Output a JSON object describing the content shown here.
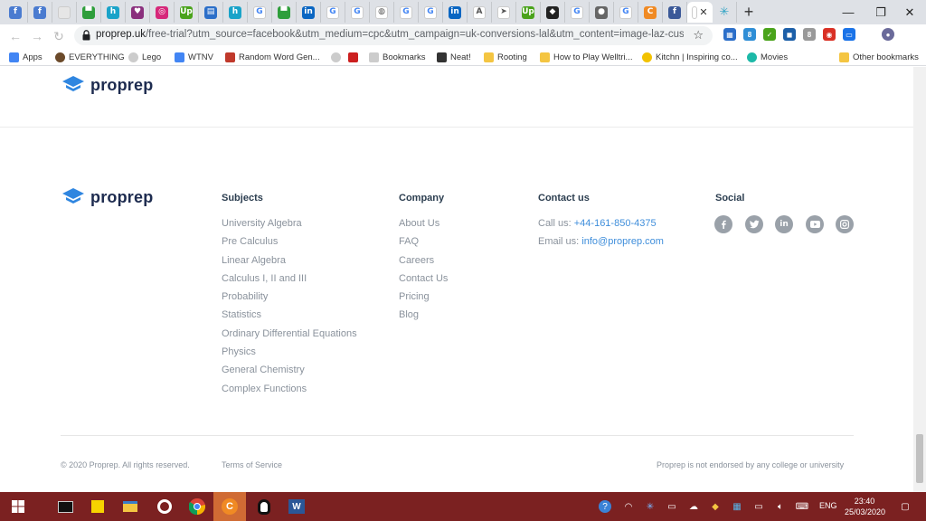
{
  "browser": {
    "tabs": [
      {
        "icon": "quora-icon",
        "glyph": "f",
        "color": "#4a7bd0"
      },
      {
        "icon": "quora-icon",
        "glyph": "f",
        "color": "#4a7bd0"
      },
      {
        "icon": "blank-page-icon",
        "glyph": "",
        "color": "#e6e6e6"
      },
      {
        "icon": "trello-icon",
        "glyph": "▀",
        "color": "#2e9e3b"
      },
      {
        "icon": "houzz-icon",
        "glyph": "h",
        "color": "#1aa3c9"
      },
      {
        "icon": "heart-app-icon",
        "glyph": "♥",
        "color": "#8a2f7d"
      },
      {
        "icon": "instagram-icon",
        "glyph": "◎",
        "color": "#d6287a"
      },
      {
        "icon": "upwork-icon",
        "glyph": "Up",
        "color": "#4aa31b"
      },
      {
        "icon": "book-icon",
        "glyph": "▤",
        "color": "#2c6fc9"
      },
      {
        "icon": "houzz-icon",
        "glyph": "h",
        "color": "#1aa3c9"
      },
      {
        "icon": "google-icon",
        "glyph": "G",
        "color": "#ffffff"
      },
      {
        "icon": "trello-icon",
        "glyph": "▀",
        "color": "#2e9e3b"
      },
      {
        "icon": "linkedin-icon",
        "glyph": "in",
        "color": "#0a66c2"
      },
      {
        "icon": "google-icon",
        "glyph": "G",
        "color": "#ffffff"
      },
      {
        "icon": "google-icon",
        "glyph": "G",
        "color": "#ffffff"
      },
      {
        "icon": "document-icon",
        "glyph": "◍",
        "color": "#ffffff"
      },
      {
        "icon": "google-icon",
        "glyph": "G",
        "color": "#ffffff"
      },
      {
        "icon": "google-icon",
        "glyph": "G",
        "color": "#ffffff"
      },
      {
        "icon": "linkedin-icon",
        "glyph": "in",
        "color": "#0a66c2"
      },
      {
        "icon": "pen-icon",
        "glyph": "A",
        "color": "#ffffff"
      },
      {
        "icon": "arrow-icon",
        "glyph": "➤",
        "color": "#ffffff"
      },
      {
        "icon": "upwork-icon",
        "glyph": "Up",
        "color": "#4aa31b"
      },
      {
        "icon": "dark-circle-icon",
        "glyph": "◆",
        "color": "#222222"
      },
      {
        "icon": "google-icon",
        "glyph": "G",
        "color": "#ffffff"
      },
      {
        "icon": "grey-circle-icon",
        "glyph": "●",
        "color": "#666666"
      },
      {
        "icon": "google-icon",
        "glyph": "G",
        "color": "#ffffff"
      },
      {
        "icon": "orange-c-icon",
        "glyph": "C",
        "color": "#f08a24"
      },
      {
        "icon": "facebook-icon",
        "glyph": "f",
        "color": "#3b5998"
      }
    ],
    "active_tab": {
      "icon": "page-icon",
      "close": "✕"
    },
    "extra_tab": {
      "icon": "snowflake-icon",
      "glyph": "✳",
      "color": "#2fa3c4"
    },
    "new_tab": "+",
    "window": {
      "minimize": "—",
      "restore": "❐",
      "close": "✕"
    },
    "url_host": "proprep.uk",
    "url_rest": "/free-trial?utm_source=facebook&utm_medium=cpc&utm_campaign=uk-conversions-lal&utm_content=image-laz-customized...",
    "star": "☆",
    "bookmarks": [
      {
        "label": "Apps",
        "icon": "apps-grid-icon",
        "color": "#4285f4"
      },
      {
        "label": "EVERYTHING",
        "icon": "user-avatar-icon",
        "color": "#6b4a2a"
      },
      {
        "label": "Lego",
        "icon": "globe-icon",
        "color": "#cccccc"
      },
      {
        "label": "WTNV",
        "icon": "google-icon",
        "color": "#4285f4"
      },
      {
        "label": "Random Word Gen...",
        "icon": "random-word-icon",
        "color": "#c0392b"
      },
      {
        "label": "",
        "icon": "globe-icon",
        "color": "#cccccc"
      },
      {
        "label": "",
        "icon": "heart-icon",
        "color": "#cc1f1f"
      },
      {
        "label": "Bookmarks",
        "icon": "star-icon",
        "color": "#cccccc"
      },
      {
        "label": "Neat!",
        "icon": "question-icon",
        "color": "#333333"
      },
      {
        "label": "Rooting",
        "icon": "folder-icon",
        "color": "#f4c542"
      },
      {
        "label": "How to Play Welltri...",
        "icon": "folder-icon",
        "color": "#f4c542"
      },
      {
        "label": "Kitchn | Inspiring co...",
        "icon": "kitchn-icon",
        "color": "#f2c200"
      },
      {
        "label": "Movies",
        "icon": "play-icon",
        "color": "#1db9a8"
      },
      {
        "label": "Other bookmarks",
        "icon": "folder-icon",
        "color": "#f4c542"
      }
    ]
  },
  "page": {
    "brand": "proprep",
    "columns": {
      "subjects": {
        "title": "Subjects",
        "items": [
          "University Algebra",
          "Pre Calculus",
          "Linear Algebra",
          "Calculus I, II and III",
          "Probability",
          "Statistics",
          "Ordinary Differential Equations",
          "Physics",
          "General Chemistry",
          "Complex Functions"
        ]
      },
      "company": {
        "title": "Company",
        "items": [
          "About Us",
          "FAQ",
          "Careers",
          "Contact Us",
          "Pricing",
          "Blog"
        ]
      },
      "contact": {
        "title": "Contact us",
        "phone_label": "Call us:",
        "phone": "+44-161-850-4375",
        "email_label": "Email us:",
        "email": "info@proprep.com"
      },
      "social": {
        "title": "Social",
        "icons": [
          "facebook-icon",
          "twitter-icon",
          "linkedin-icon",
          "youtube-icon",
          "instagram-icon"
        ]
      }
    },
    "footer": {
      "copyright": "© 2020 Proprep. All rights reserved.",
      "terms": "Terms of Service",
      "disclaimer": "Proprep is not endorsed by any college or university"
    },
    "accent_color": "#3f8edb",
    "logo_color": "#2f86e0"
  },
  "taskbar": {
    "lang": "ENG",
    "time": "23:40",
    "date": "25/03/2020",
    "color": "#7b2121"
  }
}
